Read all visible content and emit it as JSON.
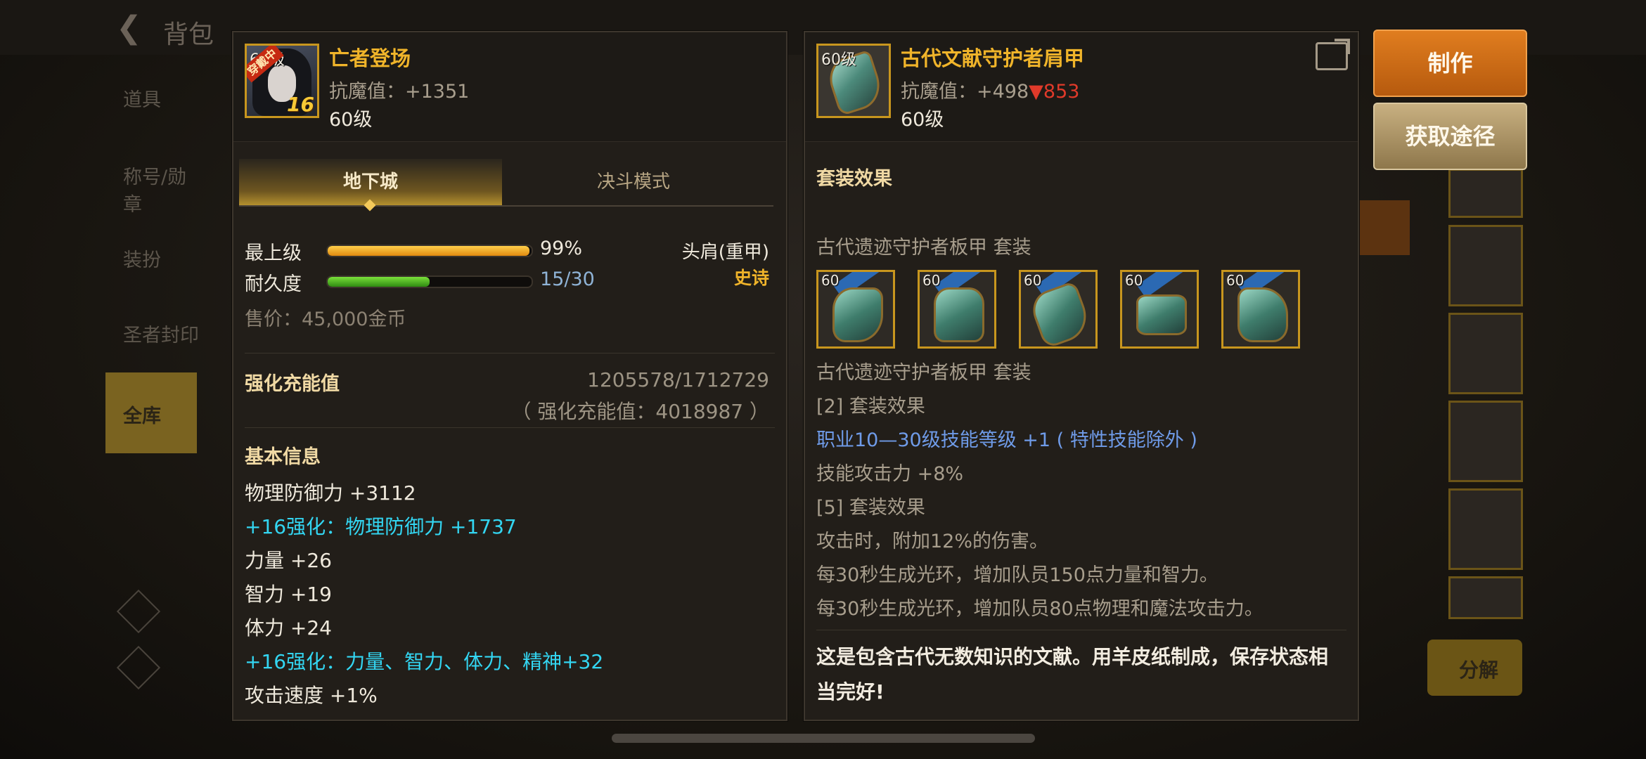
{
  "background": {
    "title": "背包",
    "sidebar": [
      "道具",
      "称号/勋章",
      "装扮",
      "圣者封印",
      "全库"
    ],
    "split_button": "分解"
  },
  "left_panel": {
    "icon_level": "60级",
    "wearing_badge": "穿戴中",
    "enhance_badge": "16",
    "name": "亡者登场",
    "stat": "抗魔值：+1351",
    "level": "60级",
    "tabs": [
      "地下城",
      "决斗模式"
    ],
    "max_level_label": "最上级",
    "max_level_value": "99%",
    "max_level_fraction": 0.99,
    "durability_label": "耐久度",
    "durability_value": "15/30",
    "durability_fraction": 0.5,
    "slot": "头肩(重甲)",
    "rarity": "史诗",
    "price": "售价：45,000金币",
    "enhance_charge_label": "强化充能值",
    "enhance_charge_value": "1205578/1712729",
    "enhance_charge_note": "（ 强化充能值：4018987 ）",
    "basic_info_title": "基本信息",
    "stats": [
      {
        "text": "物理防御力 +3112",
        "color": "white"
      },
      {
        "text": "+16强化：物理防御力 +1737",
        "color": "cyan"
      },
      {
        "text": "力量 +26",
        "color": "white"
      },
      {
        "text": "智力 +19",
        "color": "white"
      },
      {
        "text": "体力 +24",
        "color": "white"
      },
      {
        "text": "+16强化：力量、智力、体力、精神+32",
        "color": "cyan"
      },
      {
        "text": "攻击速度 +1%",
        "color": "white"
      }
    ]
  },
  "right_panel": {
    "icon_level": "60级",
    "name": "古代文献守护者肩甲",
    "stat_prefix": "抗魔值：+498",
    "stat_diff": "▼853",
    "level": "60级",
    "set_effect_title": "套装效果",
    "set_name_1": "古代遗迹守护者板甲  套装",
    "set_name_2": "古代遗迹守护者板甲  套装",
    "set_piece_level": "60",
    "effects": [
      {
        "text": "[2] 套装效果",
        "color": "gray"
      },
      {
        "text": "职业10—30级技能等级 +1 ( 特性技能除外 )",
        "color": "blue"
      },
      {
        "text": "技能攻击力 +8%",
        "color": "gray"
      },
      {
        "text": "[5] 套装效果",
        "color": "gray"
      },
      {
        "text": "攻击时，附加12%的伤害。",
        "color": "gray"
      },
      {
        "text": "每30秒生成光环，增加队员150点力量和智力。",
        "color": "gray"
      },
      {
        "text": "每30秒生成光环，增加队员80点物理和魔法攻击力。",
        "color": "gray"
      }
    ],
    "description": "这是包含古代无数知识的文献。用羊皮纸制成，保存状态相当完好!"
  },
  "buttons": {
    "craft": "制作",
    "source": "获取途径"
  },
  "colors": {
    "gold": "#f0b42a",
    "cyan": "#33d6f2",
    "blue": "#6f9be8",
    "down_red": "#e03a2a",
    "craft_orange": "#c8661a"
  }
}
